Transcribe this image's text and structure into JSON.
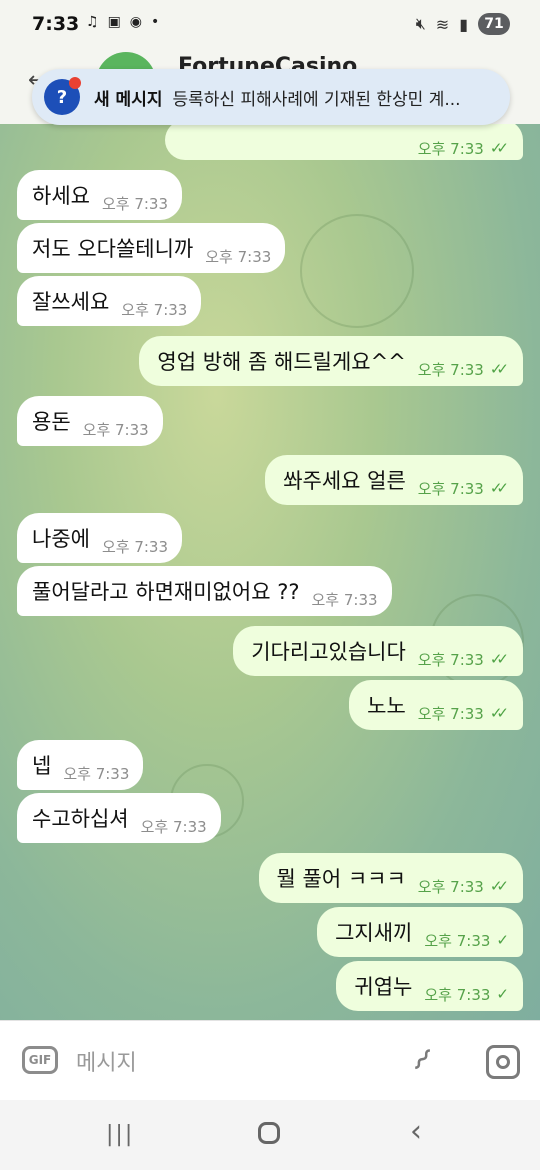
{
  "status_bar": {
    "time": "7:33",
    "left_icons": [
      "music-note-icon",
      "screenshot-icon",
      "talk-icon",
      "dot-icon"
    ],
    "right_icons": [
      "mute-icon",
      "wifi-icon",
      "signal-icon"
    ],
    "battery": "71"
  },
  "header": {
    "title": "FortuneCasino"
  },
  "notification": {
    "icon": "police-app-icon",
    "title": "새 메시지",
    "text": "등록하신 피해사례에 기재된 한상민 계..."
  },
  "messages": [
    {
      "dir": "out",
      "text": "",
      "time": "오후 7:33",
      "read": "double"
    },
    {
      "dir": "in",
      "text": "하세요",
      "time": "오후 7:33"
    },
    {
      "dir": "in",
      "text": "저도 오다쏠테니까",
      "time": "오후 7:33"
    },
    {
      "dir": "in",
      "text": "잘쓰세요",
      "time": "오후 7:33"
    },
    {
      "dir": "out",
      "text": "영업 방해 좀 해드릴게요^^",
      "time": "오후 7:33",
      "read": "double"
    },
    {
      "dir": "in",
      "text": "용돈",
      "time": "오후 7:33"
    },
    {
      "dir": "out",
      "text": "쏴주세요 얼른",
      "time": "오후 7:33",
      "read": "double"
    },
    {
      "dir": "in",
      "text": "나중에",
      "time": "오후 7:33"
    },
    {
      "dir": "in",
      "text": "풀어달라고 하면재미없어요 ??",
      "time": "오후 7:33"
    },
    {
      "dir": "out",
      "text": "기다리고있습니다",
      "time": "오후 7:33",
      "read": "double"
    },
    {
      "dir": "out",
      "text": "노노",
      "time": "오후 7:33",
      "read": "double"
    },
    {
      "dir": "in",
      "text": "넵",
      "time": "오후 7:33"
    },
    {
      "dir": "in",
      "text": "수고하십셔",
      "time": "오후 7:33"
    },
    {
      "dir": "out",
      "text": "뭘 풀어 ㅋㅋㅋ",
      "time": "오후 7:33",
      "read": "double"
    },
    {
      "dir": "out",
      "text": "그지새끼",
      "time": "오후 7:33",
      "read": "single"
    },
    {
      "dir": "out",
      "text": "귀엽누",
      "time": "오후 7:33",
      "read": "single"
    }
  ],
  "composer": {
    "gif_label": "GIF",
    "placeholder": "메시지"
  },
  "nav": {
    "recent_icon": "recent-apps-icon",
    "home_icon": "home-icon",
    "back_icon": "back-icon"
  }
}
